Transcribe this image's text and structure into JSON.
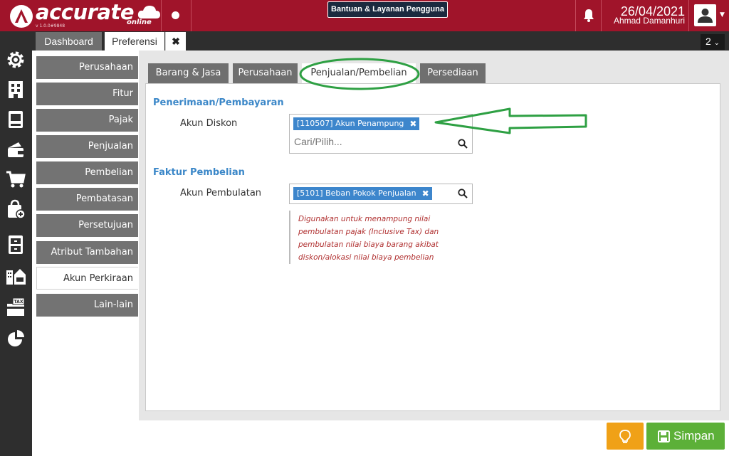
{
  "header": {
    "brand": "accurate",
    "brand_suffix": "online",
    "version": "v 1.0.0#9848",
    "help_button": "Bantuan & Layanan Pengguna",
    "date": "26/04/2021",
    "user_name": "Ahmad Damanhuri",
    "brand_color": "#a0142a"
  },
  "doc_tabs": {
    "dashboard": "Dashboard",
    "preferensi": "Preferensi",
    "close": "✖",
    "count": "2",
    "count_caret": "⌄"
  },
  "rail_icons": [
    "gear-icon",
    "building-icon",
    "book-icon",
    "wallet-icon",
    "cart-icon",
    "bag-add-icon",
    "cabinet-icon",
    "city-icon",
    "tax-icon",
    "pie-chart-icon"
  ],
  "pref_menu": {
    "items": [
      "Perusahaan",
      "Fitur",
      "Pajak",
      "Penjualan",
      "Pembelian",
      "Pembatasan",
      "Persetujuan",
      "Atribut Tambahan",
      "Akun Perkiraan",
      "Lain-lain"
    ],
    "active": "Akun Perkiraan"
  },
  "inner_tabs": {
    "items": [
      "Barang & Jasa",
      "Perusahaan",
      "Penjualan/Pembelian",
      "Persediaan"
    ],
    "active": "Penjualan/Pembelian"
  },
  "sections": {
    "penerimaan": {
      "title": "Penerimaan/Pembayaran",
      "akun_diskon_label": "Akun Diskon",
      "akun_diskon_value": "[110507] Akun Penampung",
      "search_placeholder": "Cari/Pilih..."
    },
    "faktur": {
      "title": "Faktur Pembelian",
      "akun_pembulatan_label": "Akun Pembulatan",
      "akun_pembulatan_value": "[5101] Beban Pokok Penjualan",
      "note_lines": [
        "Digunakan untuk menampung nilai",
        "pembulatan pajak (Inclusive Tax) dan",
        "pembulatan nilai biaya barang akibat",
        "diskon/alokasi nilai biaya pembelian"
      ]
    }
  },
  "buttons": {
    "save": "Simpan",
    "save_color": "#5cb038",
    "bulb_color": "#f0a117"
  },
  "annotation_color": "#2ea043"
}
